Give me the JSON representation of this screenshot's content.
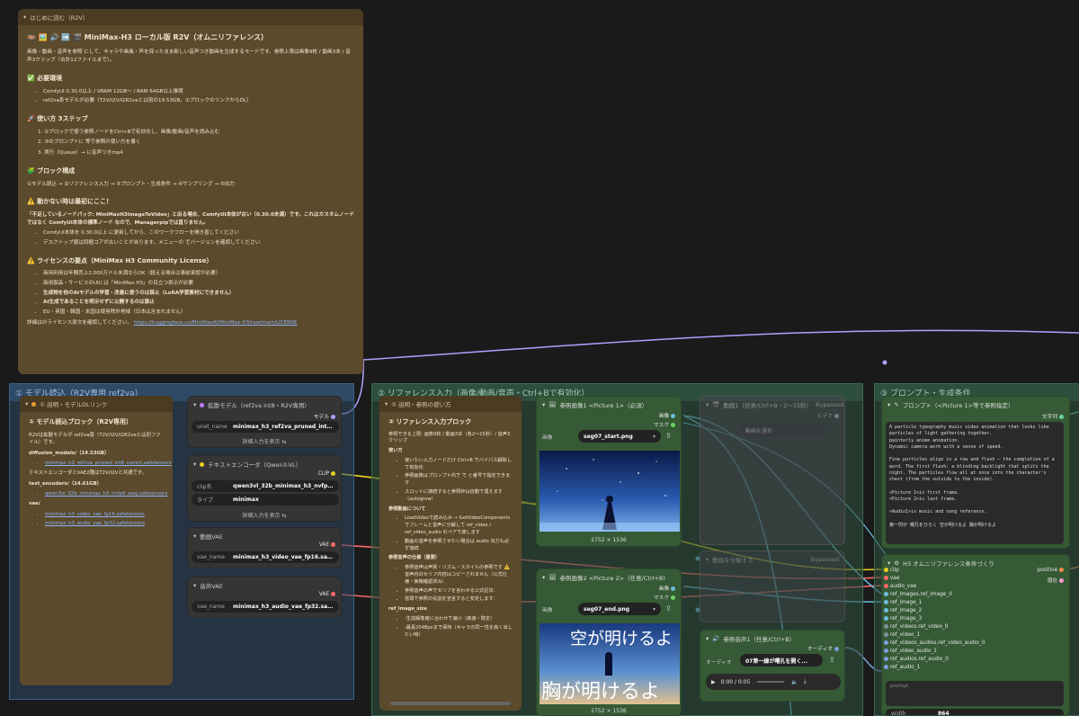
{
  "colors": {
    "bg": "#1a1a1a",
    "note": "#5b4a2c",
    "group_blue": "#2e4a66",
    "group_green": "#2e4e3e",
    "accent_link": "#b0a0ff"
  },
  "intro_note": {
    "title": "はじめに読む（R2V）",
    "heading": "🎞️ 🖼️ 🔊 ➡️ 🎬 MiniMax-H3 ローカル版 R2V（オムニリファレンス）",
    "desc": "画像・動画・音声を参照 にして、キャラや画風・声を保ったまま新しい音声つき動画を生成するモードです。参照上限は画像9枚 / 動画3本 / 音声3クリップ（合計12ファイルまで）。",
    "env_title": "✅ 必要環境",
    "env_items": [
      "ComfyUI 0.30.0以上 / VRAM 12GB〜 / RAM 64GB以上推奨",
      "ref2va系モデルが必要（T2V/I2V/I2R2veとは別の19.53GB。①ブロックのリンクからDL）"
    ],
    "steps_title": "🚀 使い方 3ステップ",
    "steps": [
      "1. ②ブロックで使う参照ノードをCtrl+Bで有効化し、画像/動画/音声を読み込む",
      "2. ③のプロンプトに            等で参照の使い方を書く",
      "3. 実行（Queue）→              に音声つきmp4"
    ],
    "blocks_title": "🧩 ブロック構成",
    "blocks_line": "①モデル読込 → ②リファレンス入力 → ③プロンプト・生成条件 → ④サンプリング → ⑤出力",
    "warn_title": "⚠️ 動かない時は最初にここ！",
    "warn_desc": "「不足しているノードパック: MiniMaxH3ImageToVideo」と出る場合、ComfyUI本体が古い（0.30.0未満）です。これはカスタムノードではなく ComfyUI本体の標準ノード なので、Managerpipでは直りません。",
    "warn_items": [
      "ComfyUI本体を 0.30.0以上 に更新してから、このワークフローを開き直してください",
      "デスクトップ版は同梱コアが古いことがあります。メニューの              でバージョンを確認してください"
    ],
    "license_title": "⚠️ ライセンスの要点（MiniMax H3 Community License）",
    "license_items": [
      "商用利用は年間売上2,000万ドル未満ならOK（超える場合は事前承認が必要）",
      "商用製品・サービスのUIには「MiniMax H3」の目立つ表示が必要",
      "生成物を他のAIモデルの学習・改善に使うのは禁止（LoRA学習素材にできません）",
      "AI生成であることを明示せずに公開するのは禁止",
      "EU・英国・韓国・米国は使用除外地域（日本は含まれません）"
    ],
    "license_footer": "詳細はのライセンス原文を確認してください。",
    "license_url": "https://huggingface.co/MiniMaxAI/MiniMax-H3/raw/main/LICENSE"
  },
  "group_model": {
    "title": "① モデル読込（R2V専用 ref2va）"
  },
  "group_ref": {
    "title": "② リファレンス入力（画像/動画/音声・Ctrl+Bで有効化）"
  },
  "group_prompt": {
    "title": "③ プロンプト・生成条件"
  },
  "model_note": {
    "title": "① 説明・モデルDLリンク",
    "heading": "① モデル読込ブロック（R2V専用）",
    "p1": "R2Vは拡散モデルが ref2va版（T2V/I2V/I2R2veとは別ファイル）です。",
    "sec1": "diffusion_models/（19.53GB）",
    "link1": "minimax_h3_ref2va_pruned_int8_comnt.safetensors",
    "p2": "テキストエンコーダとVAE2種はT2V/I2Vと共通です。",
    "sec2": "text_encoders/（14.61GB）",
    "link2": "qwen3vl_32b_minimax_h3_nvfp4_awq.safetensors",
    "sec3": "vae/",
    "link3": "minimax_h3_video_vae_fp16.safetensors",
    "link4": "minimax_h3_audio_vae_fp32.safetensors"
  },
  "diffusion_node": {
    "title": "拡散モデル（ref2va int8・R2V専用）",
    "out": "モデル",
    "label": "unet_name",
    "value": "minimax_h3_ref2va_pruned_int8_con...",
    "expand": "詳細入力を表示"
  },
  "text_enc_node": {
    "title": "テキストエンコーダ（Qwen3-VL）",
    "out": "CLIP",
    "label1": "clip名",
    "value1": "qwen3vl_32b_minimax_h3_nvfp4_aw...",
    "label2": "タイプ",
    "value2": "minimax",
    "expand": "詳細入力を表示"
  },
  "video_vae_node": {
    "title": "動画VAE",
    "out": "VAE",
    "label": "vae_name",
    "value": "minimax_h3_video_vae_fp16.safeten..."
  },
  "audio_vae_node": {
    "title": "音声VAE",
    "out": "VAE",
    "label": "vae_name",
    "value": "minimax_h3_audio_vae_fp32.safeten..."
  },
  "ref_note": {
    "title": "② 説明・参照の使い方",
    "heading": "② リファレンス入力ブロック",
    "p1": "参照できる上限: 画像9枚 / 動画3本（各2〜15秒）/ 音声3クリップ",
    "sec_use": "使い方",
    "use_items": [
      "使いたい入力ノードだけ Ctrl+B でバイパス解除して有効化",
      "参照画像はプロンプト内で              で       と番号で指定できます",
      "スロットに接続すると参照枠は自動で埋えます（autogrow）"
    ],
    "sec_video": "参照動画について",
    "video_items": [
      "LoadVideoで読み込み → GetVideoComponentsでフレームと音声に分解して ref_video / ref_video_audio のペアで渡します",
      "動画の音声を参照させたい場合は audio 出力も必ず接続"
    ],
    "sec_audio": "参照音声の仕様（重要）",
    "audio_items": [
      "参照音声は声質・リズム・スタイルの参照です ⚠️ 音声内のセリフ内容はコピーされません（公式仕様・実機確認済み）",
      "参照音声の声でセリフを言わせる公式記法:",
      "冒頭で参照の役割を宣言すると安定します:"
    ],
    "sec_size": "ref_image_size",
    "size_items": [
      "      :生成解像度に合わせて縮小（高速・既定）",
      "      :最長2048pxまで保持（キャラの同一性を高く出したい時）"
    ]
  },
  "pic1_node": {
    "title": "参照画像1 <Picture 1>（必須）",
    "out1": "画像",
    "out2": "マスク",
    "label": "画像",
    "file": "seg07_start.png",
    "dims": "2752 × 1536"
  },
  "pic2_node": {
    "title": "参照画像2 <Picture 2>（任意/Ctrl+B)",
    "out1": "画像",
    "out2": "マスク",
    "label": "画像",
    "file": "seg07_end.png",
    "dims": "2752 × 1536",
    "img_text_top": "空が明けるよ",
    "img_text_bottom": "胸が明けるよ"
  },
  "video_ref_node": {
    "title": "動画1（任意/Ctrl+B・2〜15秒）",
    "badge": "Bypassed ⊘",
    "out": "ビデオ",
    "select": "動画を選択"
  },
  "video_split_node": {
    "title": "動画を分解する",
    "badge": "Bypassed"
  },
  "audio_ref_node": {
    "title": "参照音声1（任意/Ctrl+B）",
    "out": "オーディオ",
    "label": "オーディオ",
    "file": "07第一線が曙孔を開く...",
    "time": "0:00 / 0:05"
  },
  "prompt_node": {
    "title": "プロンプト（<Picture 1>等で参照指定）",
    "out": "文字列",
    "text": "A particle typography music video animation that looks like particles of light gathering together.\npainterly anime animation.\nDynamic camera work with a sense of speed.\n\nFine particles align in a row and flash — the completion of a word. The first flash: a blinding backlight that splits the night. The particles flow all at once into the character's chest (from the outside to the inside).\n\n<Picture 1>is first frame.\n<Picture 2>is last frame.\n\n<Audio1>is music and song reference.\n\n第一閃が 曙孔をひらく 空が明けるよ 胸が明けるよ"
  },
  "cond_node": {
    "title": "H3 オムニリファレンス条件づくり",
    "out1": "positive",
    "out2": "潜在",
    "inputs": [
      "clip",
      "vae",
      "audio_vae",
      "ref_images.ref_image_0",
      "ref_image_1",
      "ref_image_2",
      "ref_image_3",
      "ref_videos.ref_video_0",
      "ref_video_1",
      "ref_videos_audios.ref_video_audio_0",
      "ref_video_audio_1",
      "ref_audios.ref_audio_0",
      "ref_audio_1"
    ],
    "prompt_placeholder": "prompt",
    "width_label": "width",
    "width_value": "864"
  }
}
